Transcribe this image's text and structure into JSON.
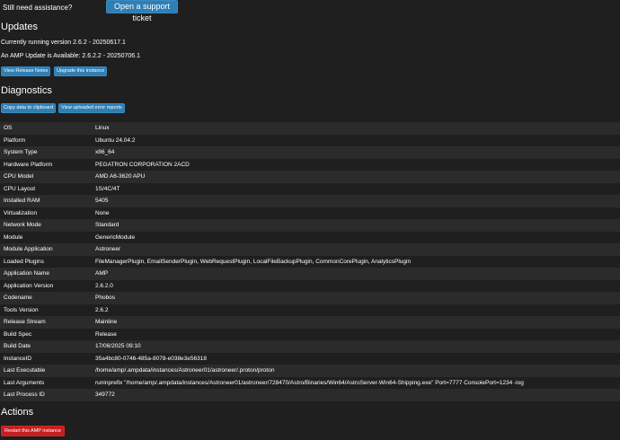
{
  "support": {
    "prompt": "Still need assistance?",
    "ticket_button": "Open a support ticket"
  },
  "updates": {
    "title": "Updates",
    "current_version": "Currently running version 2.6.2 - 20250617.1",
    "available": "An AMP Update is Available: 2.6.2.2 - 20250706.1",
    "release_notes_button": "View Release Notes",
    "upgrade_button": "Upgrade this instance"
  },
  "diagnostics": {
    "title": "Diagnostics",
    "copy_button": "Copy data to clipboard",
    "view_reports_button": "View uploaded error reports",
    "rows": [
      {
        "key": "OS",
        "value": "Linux"
      },
      {
        "key": "Platform",
        "value": "Ubuntu 24.04.2"
      },
      {
        "key": "System Type",
        "value": "x86_64"
      },
      {
        "key": "Hardware Platform",
        "value": "PEGATRON CORPORATION 2ACD"
      },
      {
        "key": "CPU Model",
        "value": "AMD A6-3620 APU"
      },
      {
        "key": "CPU Layout",
        "value": "1S/4C/4T"
      },
      {
        "key": "Installed RAM",
        "value": "5405"
      },
      {
        "key": "Virtualization",
        "value": "None"
      },
      {
        "key": "Network Mode",
        "value": "Standard"
      },
      {
        "key": "Module",
        "value": "GenericModule"
      },
      {
        "key": "Module Application",
        "value": "Astroneer"
      },
      {
        "key": "Loaded Plugins",
        "value": "FileManagerPlugin, EmailSenderPlugin, WebRequestPlugin, LocalFileBackupPlugin, CommonCorePlugin, AnalyticsPlugin"
      },
      {
        "key": "Application Name",
        "value": "AMP"
      },
      {
        "key": "Application Version",
        "value": "2.6.2.0"
      },
      {
        "key": "Codename",
        "value": "Phobos"
      },
      {
        "key": "Tools Version",
        "value": "2.6.2"
      },
      {
        "key": "Release Stream",
        "value": "Mainline"
      },
      {
        "key": "Build Spec",
        "value": "Release"
      },
      {
        "key": "Build Date",
        "value": "17/06/2025 09:10"
      },
      {
        "key": "InstanceID",
        "value": "35a4bc80-0746-485a-8078-e038e3e56318"
      },
      {
        "key": "Last Executable",
        "value": "/home/amp/.ampdata/instances/Astroneer01/astroneer/.proton/proton"
      },
      {
        "key": "Last Arguments",
        "value": "runinprefix \"/home/amp/.ampdata/instances/Astroneer01/astroneer/728470/Astro/Binaries/Win64/AstroServer-Win64-Shipping.exe\" Port=7777 ConsolePort=1234 -log"
      },
      {
        "key": "Last Process ID",
        "value": "349772"
      }
    ]
  },
  "actions": {
    "title": "Actions",
    "restart_button": "Restart this AMP instance"
  }
}
